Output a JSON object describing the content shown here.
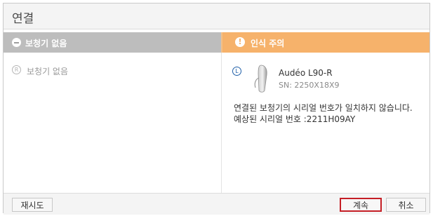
{
  "window": {
    "title": "연결"
  },
  "left_panel": {
    "header": "보청기 없음",
    "item_badge": "R",
    "item_label": "보청기 없음"
  },
  "right_panel": {
    "header": "인식 주의",
    "warning_glyph": "!",
    "device": {
      "side_badge": "L",
      "name": "Audéo L90-R",
      "serial": "SN: 2250X18X9"
    },
    "message_line1": "연결된 보청기의 시리얼 번호가 일치하지 않습니다.",
    "message_line2": "예상된 시리얼 번호 :2211H09AY"
  },
  "footer": {
    "retry_label": "재시도",
    "continue_label": "계속",
    "cancel_label": "취소"
  },
  "colors": {
    "warning_header": "#f6b26b",
    "neutral_header": "#bdbdbd",
    "highlight_border": "#c51f26",
    "badge_blue": "#1f5fa8"
  }
}
